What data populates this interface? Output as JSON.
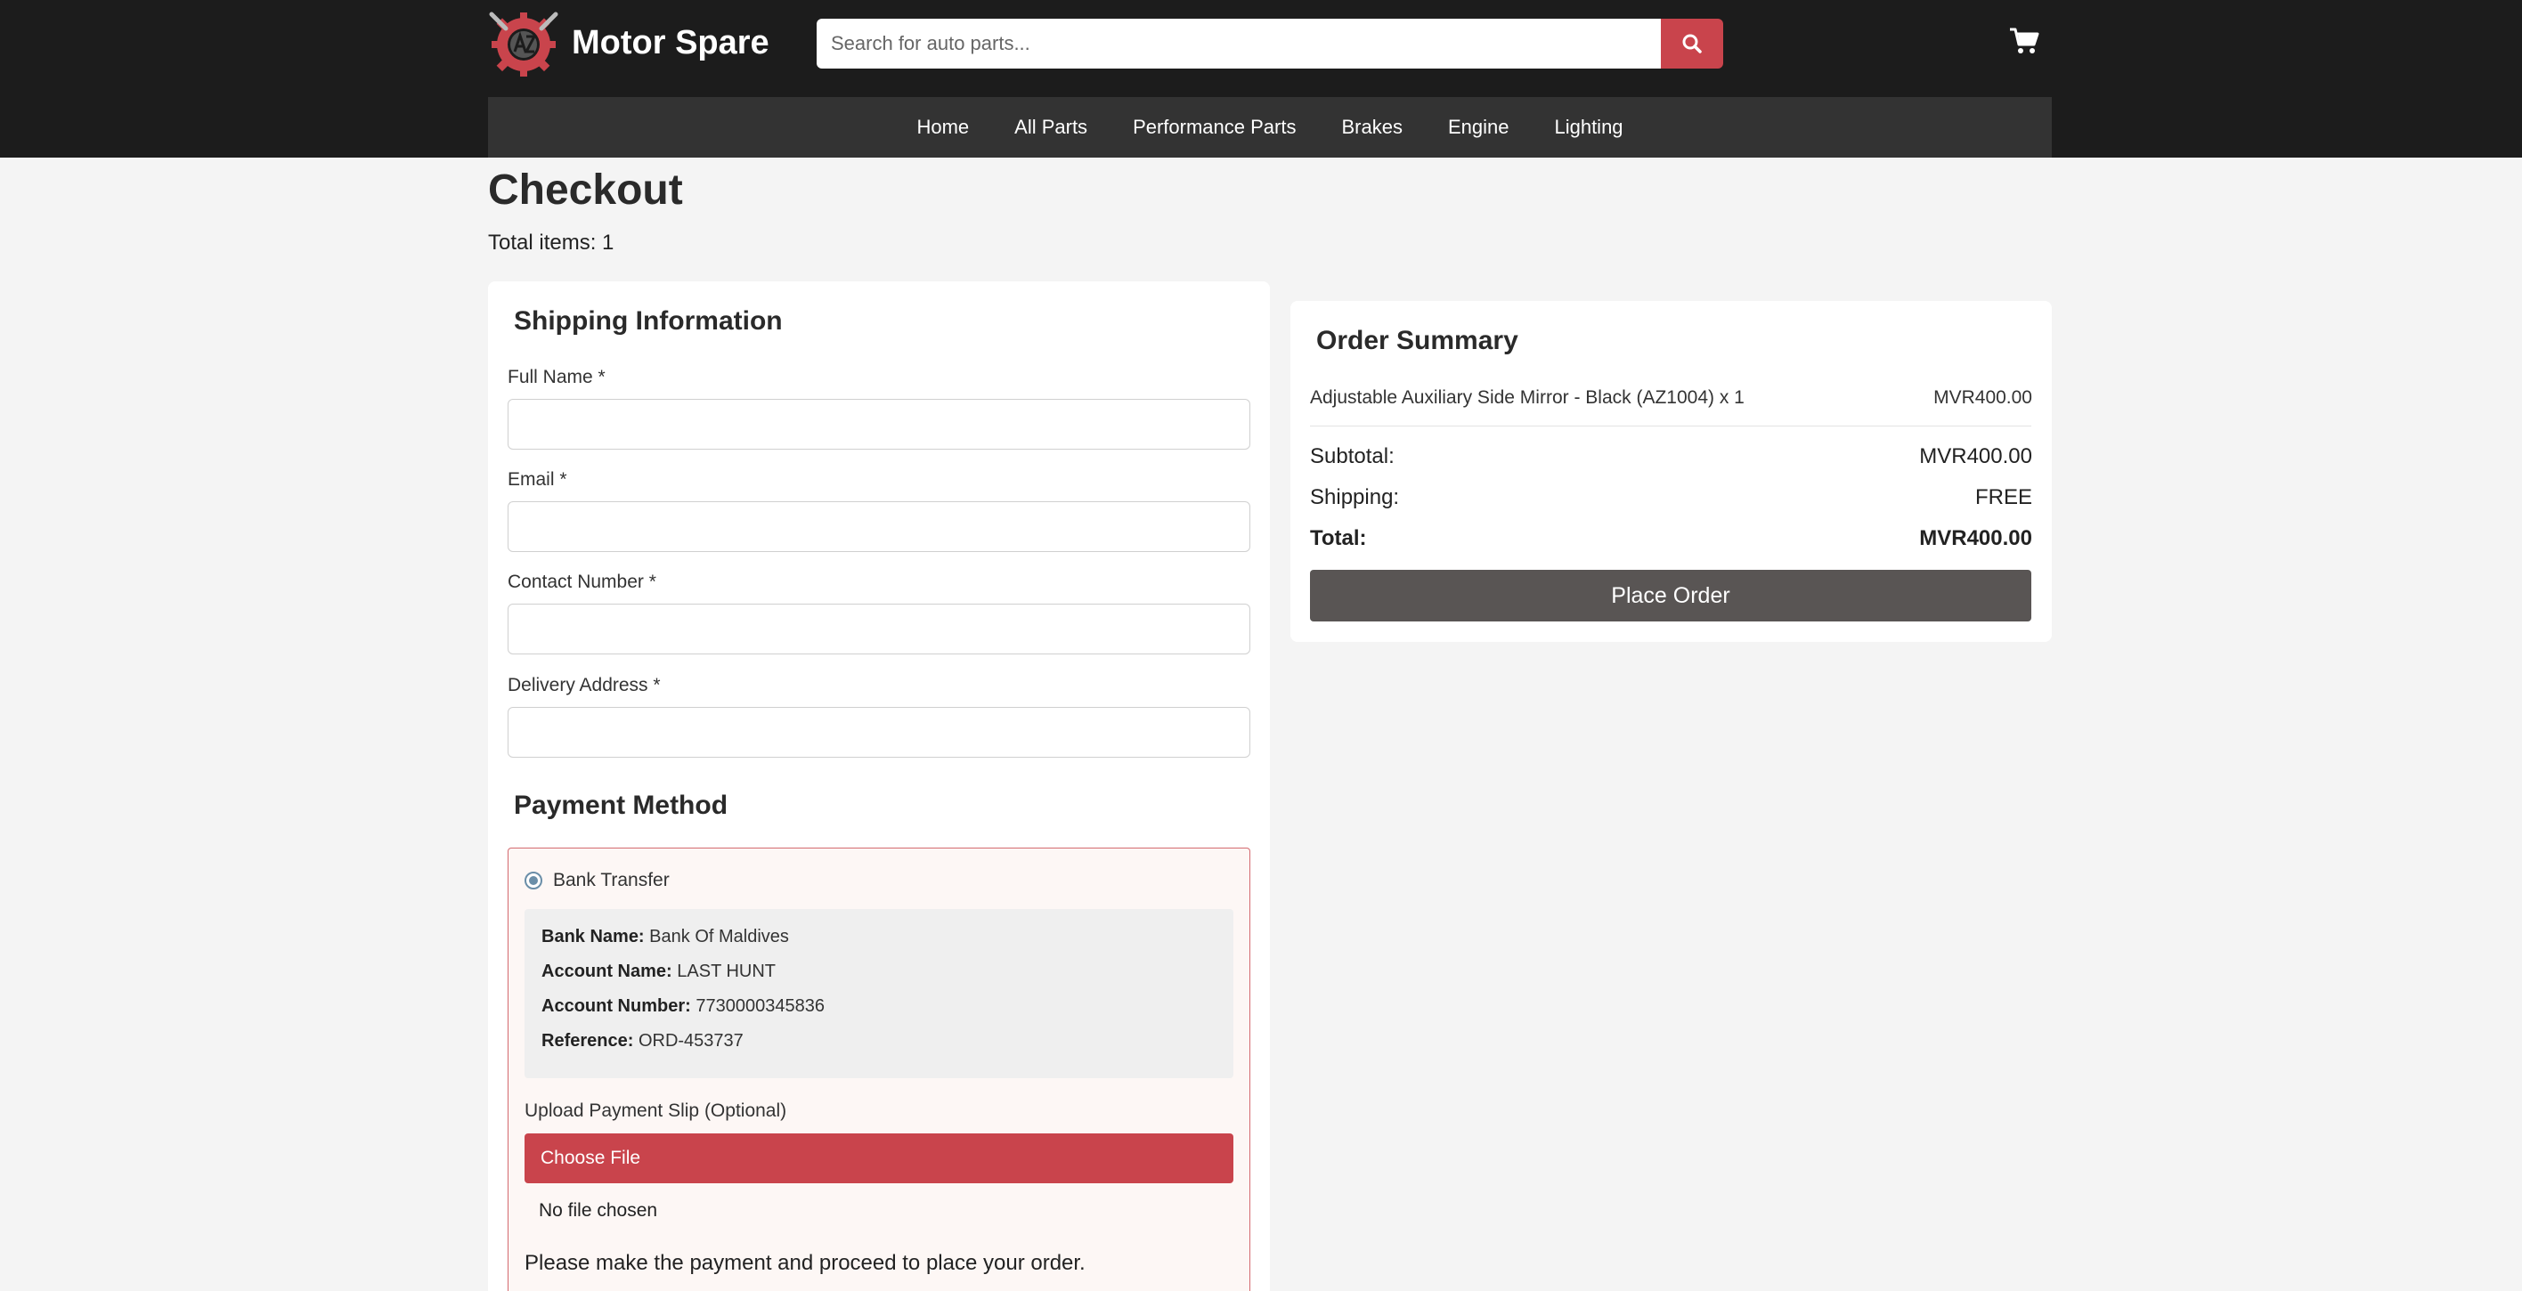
{
  "header": {
    "brand": "Motor Spare",
    "search_placeholder": "Search for auto parts...",
    "accent_color": "#c9444c"
  },
  "nav": {
    "items": [
      "Home",
      "All Parts",
      "Performance Parts",
      "Brakes",
      "Engine",
      "Lighting"
    ]
  },
  "page": {
    "title": "Checkout",
    "total_items": "Total items: 1"
  },
  "shipping": {
    "title": "Shipping Information",
    "full_name_label": "Full Name *",
    "full_name_value": "",
    "email_label": "Email *",
    "email_value": "",
    "contact_label": "Contact Number *",
    "contact_value": "",
    "address_label": "Delivery Address *",
    "address_value": ""
  },
  "payment": {
    "title": "Payment Method",
    "option_label": "Bank Transfer",
    "bank_name_key": "Bank Name:",
    "bank_name": "Bank Of Maldives",
    "account_name_key": "Account Name:",
    "account_name": "LAST HUNT",
    "account_number_key": "Account Number:",
    "account_number": "7730000345836",
    "reference_key": "Reference:",
    "reference": "ORD-453737",
    "upload_label": "Upload Payment Slip (Optional)",
    "choose_file": "Choose File",
    "no_file": "No file chosen",
    "note": "Please make the payment and proceed to place your order."
  },
  "summary": {
    "title": "Order Summary",
    "item_name": "Adjustable Auxiliary Side Mirror - Black (AZ1004) x 1",
    "item_price": "MVR400.00",
    "subtotal_label": "Subtotal:",
    "subtotal": "MVR400.00",
    "shipping_label": "Shipping:",
    "shipping": "FREE",
    "total_label": "Total:",
    "total": "MVR400.00",
    "place_order": "Place Order"
  }
}
